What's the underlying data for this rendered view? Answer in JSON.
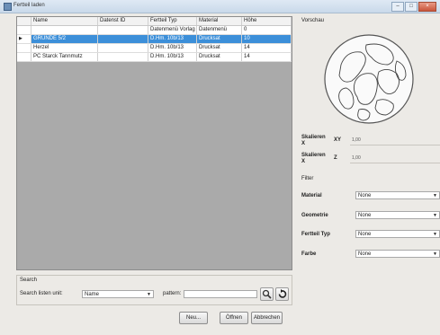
{
  "window": {
    "title": "Fertteil laden"
  },
  "grid": {
    "columns": [
      "",
      "Name",
      "Datenst ID",
      "Fertteil Typ",
      "Material",
      "Höhe"
    ],
    "rows": [
      {
        "marker": "",
        "name": "",
        "id": "",
        "type": "Datenmenü Vorlag",
        "material": "Datenmenü",
        "height": "0",
        "selected": false
      },
      {
        "marker": "▶",
        "name": "GRÜNDE 5/2",
        "id": "",
        "type": "D.Hm. 10b/13",
        "material": "Drucksat",
        "height": "10",
        "selected": true
      },
      {
        "marker": "",
        "name": "Herzel",
        "id": "",
        "type": "D.Hm. 10b/13",
        "material": "Drucksat",
        "height": "14",
        "selected": false
      },
      {
        "marker": "",
        "name": "PC Starck Tannmutz",
        "id": "",
        "type": "D.Hm. 10b/13",
        "material": "Drucksat",
        "height": "14",
        "selected": false
      }
    ]
  },
  "search": {
    "group_label": "Search",
    "field_label": "Search listen unit:",
    "field_value": "Name",
    "pattern_label": "pattern:",
    "pattern_value": ""
  },
  "buttons": {
    "new": "Neu...",
    "open": "Öffnen",
    "cancel": "Abbrechen"
  },
  "preview": {
    "label": "Vorschau",
    "fields": [
      {
        "label": "Skalieren",
        "sub": "X",
        "suffix": "XY",
        "value": "1,00"
      },
      {
        "label": "Skalieren",
        "sub": "X",
        "suffix": "Z",
        "value": "1,00"
      }
    ],
    "filter_label": "Filter",
    "filters": [
      {
        "label": "Material",
        "value": "None"
      },
      {
        "label": "Geometrie",
        "value": "None"
      },
      {
        "label": "Fertteil Typ",
        "value": "None"
      },
      {
        "label": "Farbe",
        "value": "None"
      }
    ]
  },
  "colors": {
    "selection": "#3c8fd9",
    "grid_empty": "#aaaaaa",
    "window_bg": "#eceae6"
  }
}
